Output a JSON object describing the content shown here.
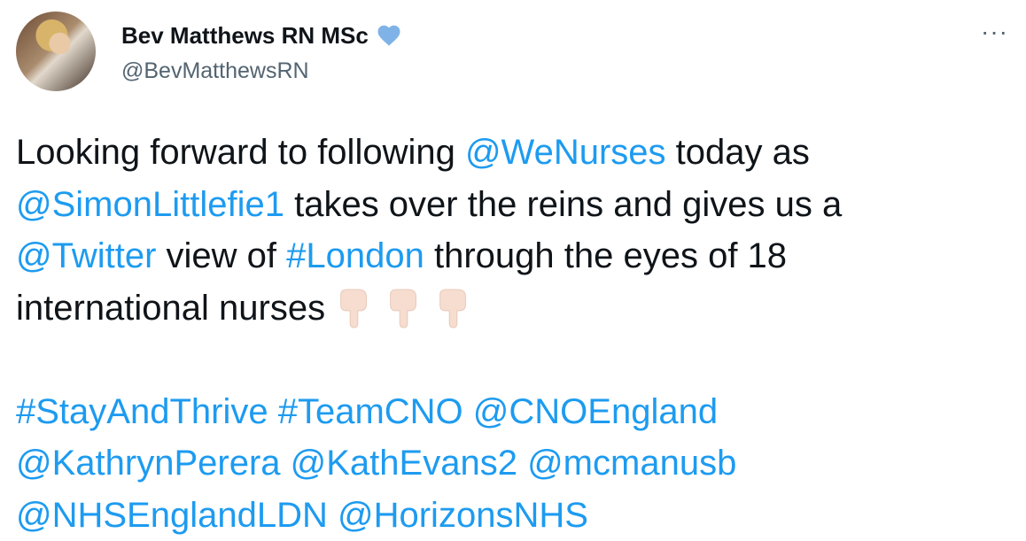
{
  "author": {
    "display_name": "Bev Matthews RN MSc",
    "handle": "@BevMatthewsRN",
    "avatar_icon": "profile-photo",
    "verified_icon": "heart-icon",
    "verified_color": "#7fb3e8"
  },
  "menu": {
    "icon": "more-options-icon",
    "label": "···"
  },
  "tweet": {
    "line1": {
      "t1": "Looking forward to following ",
      "l1": "@WeNurses",
      "t2": " today as"
    },
    "line2": {
      "l1": "@SimonLittlefie1",
      "t1": " takes over the reins and gives us a"
    },
    "line3": {
      "l1": "@Twitter",
      "t1": " view of ",
      "l2": "#London",
      "t2": " through the eyes of 18"
    },
    "line4": {
      "t1": "international nurses",
      "emoji_icon": "backhand-index-pointing-down-light-skin-tone",
      "emoji_count": 3
    },
    "line5": {
      "l1": "#StayAndThrive",
      "l2": "#TeamCNO",
      "l3": "@CNOEngland"
    },
    "line6": {
      "l1": "@KathrynPerera",
      "l2": "@KathEvans2",
      "l3": "@mcmanusb"
    },
    "line7": {
      "l1": "@NHSEnglandLDN",
      "l2": "@HorizonsNHS"
    }
  },
  "colors": {
    "link": "#1d9bf0",
    "text": "#0f1419",
    "secondary": "#536471"
  }
}
